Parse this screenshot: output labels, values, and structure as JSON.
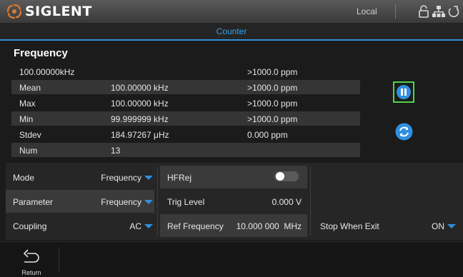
{
  "brand": {
    "name": "SIGLENT",
    "accent": "#2f90e0",
    "logo_color": "#e07a2e"
  },
  "status": {
    "mode_label": "Local"
  },
  "screen": {
    "title": "Counter"
  },
  "measurement": {
    "title": "Frequency",
    "rows": [
      {
        "label": "100.00000kHz",
        "value": "",
        "ppm": ">1000.0 ppm"
      },
      {
        "label": "Mean",
        "value": "100.00000 kHz",
        "ppm": ">1000.0 ppm"
      },
      {
        "label": "Max",
        "value": "100.00000 kHz",
        "ppm": ">1000.0 ppm"
      },
      {
        "label": "Min",
        "value": "99.999999 kHz",
        "ppm": ">1000.0 ppm"
      },
      {
        "label": "Stdev",
        "value": "184.97267 μHz",
        "ppm": "0.000 ppm"
      },
      {
        "label": "Num",
        "value": "13",
        "ppm": ""
      }
    ]
  },
  "settings": {
    "mode": {
      "label": "Mode",
      "value": "Frequency"
    },
    "parameter": {
      "label": "Parameter",
      "value": "Frequency"
    },
    "coupling": {
      "label": "Coupling",
      "value": "AC"
    },
    "hfrej": {
      "label": "HFRej",
      "state": "off"
    },
    "trig_level": {
      "label": "Trig Level",
      "value": "0.000 V"
    },
    "ref_frequency": {
      "label": "Ref Frequency",
      "value": "10.000 000  MHz"
    },
    "stop_when_exit": {
      "label": "Stop When Exit",
      "value": "ON"
    }
  },
  "icons": {
    "logo": "siglent-logo-icon",
    "lock": "unlock-icon",
    "network": "network-icon",
    "power": "power-icon",
    "pause": "pause-icon",
    "refresh": "refresh-icon",
    "return": "return-arrow-icon"
  },
  "bottom": {
    "return_label": "Return"
  }
}
